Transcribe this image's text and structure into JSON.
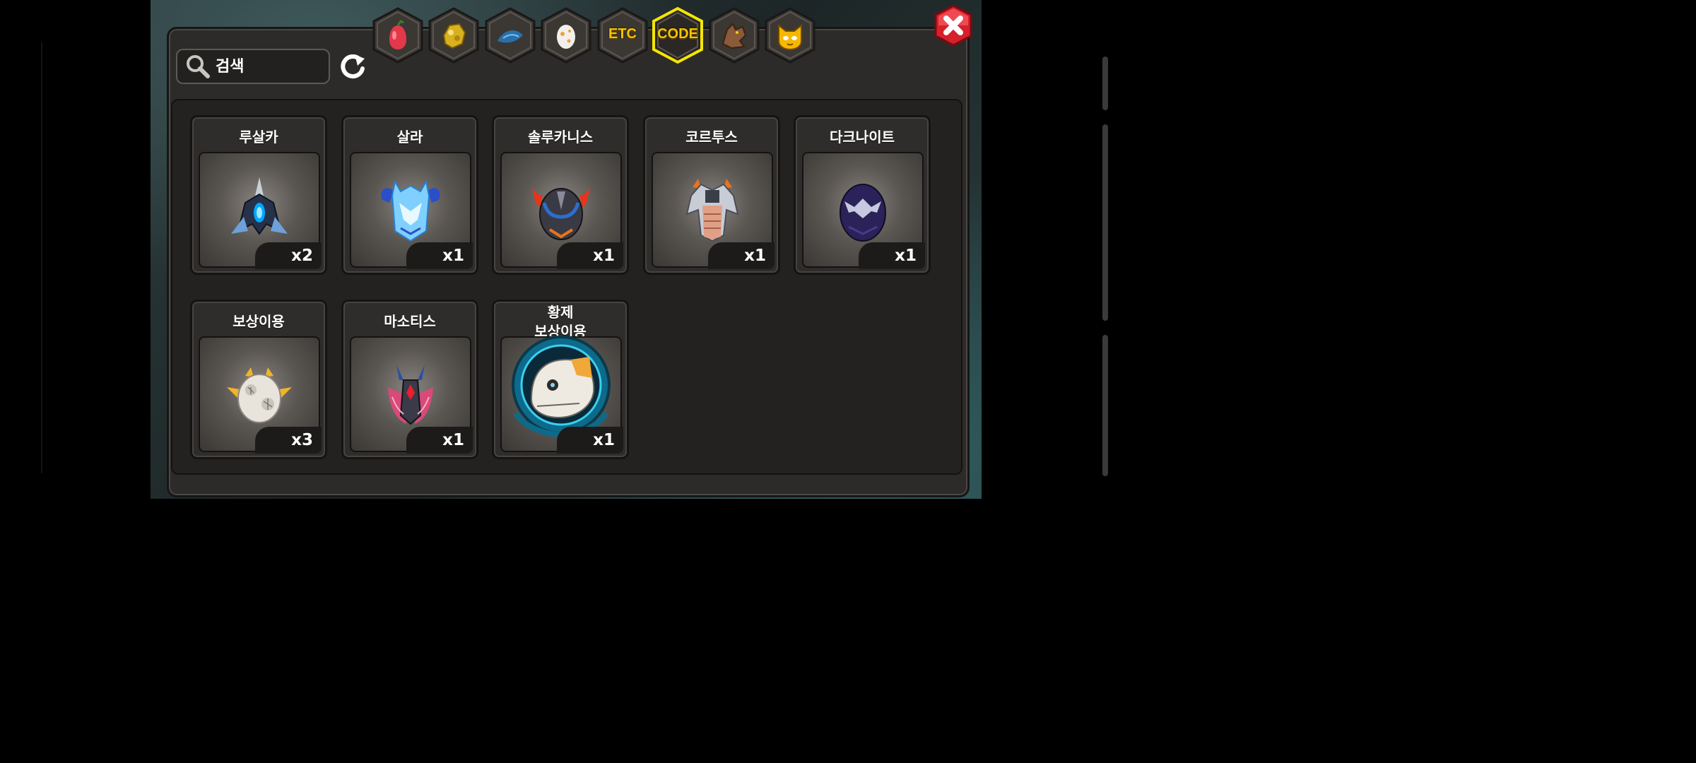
{
  "search": {
    "placeholder": "검색"
  },
  "tabs": [
    {
      "name": "fruit-tab",
      "icon": "pear-icon",
      "text": ""
    },
    {
      "name": "gold-tab",
      "icon": "gold-ore-icon",
      "text": ""
    },
    {
      "name": "fish-tab",
      "icon": "blue-fish-icon",
      "text": ""
    },
    {
      "name": "egg-tab",
      "icon": "egg-icon",
      "text": ""
    },
    {
      "name": "etc-tab",
      "icon": "",
      "text": "ETC"
    },
    {
      "name": "code-tab",
      "icon": "",
      "text": "CODE",
      "selected": true
    },
    {
      "name": "dragon-tab",
      "icon": "brown-dragon-icon",
      "text": ""
    },
    {
      "name": "monster-tab",
      "icon": "yellow-cat-face-icon",
      "text": ""
    }
  ],
  "items": [
    {
      "name": "루살카",
      "count": "x2",
      "icon": "dark-blue-fin-egg-icon"
    },
    {
      "name": "살라",
      "count": "x1",
      "icon": "ice-horned-egg-icon"
    },
    {
      "name": "솔루카니스",
      "count": "x1",
      "icon": "flame-horned-egg-icon"
    },
    {
      "name": "코르투스",
      "count": "x1",
      "icon": "armored-spike-egg-icon"
    },
    {
      "name": "다크나이트",
      "count": "x1",
      "icon": "purple-dark-egg-icon"
    },
    {
      "name": "보상이용",
      "count": "x3",
      "icon": "winged-white-egg-icon"
    },
    {
      "name": "마소티스",
      "count": "x1",
      "icon": "pink-winged-egg-icon"
    },
    {
      "name": "황제\n보상이용",
      "name_line1": "황제",
      "name_line2": "보상이용",
      "count": "x1",
      "icon": "emperor-portrait-icon"
    }
  ],
  "colors": {
    "accent": "#f6c400",
    "close": "#d6202a",
    "panel": "#2d2b29"
  }
}
